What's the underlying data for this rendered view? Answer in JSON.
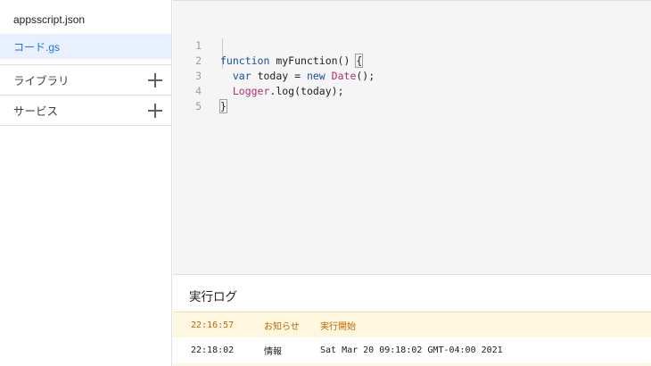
{
  "sidebar": {
    "files": [
      {
        "label": "appsscript.json",
        "selected": false
      },
      {
        "label": "コード.gs",
        "selected": true
      }
    ],
    "sections": [
      {
        "label": "ライブラリ",
        "add_icon": "plus-icon"
      },
      {
        "label": "サービス",
        "add_icon": "plus-icon"
      }
    ]
  },
  "editor": {
    "line_numbers": [
      "1",
      "2",
      "3",
      "4",
      "5"
    ],
    "code": {
      "l1_kw": "function",
      "l1_rest": " myFunction() ",
      "l1_brace": "{",
      "l2_indent": "  ",
      "l2_kw": "var",
      "l2_mid": " today = ",
      "l2_new": "new",
      "l2_sp": " ",
      "l2_cls": "Date",
      "l2_end": "();",
      "l3_indent": "  ",
      "l3_obj": "Logger",
      "l3_rest": ".log(today);",
      "l4_brace": "}"
    }
  },
  "log": {
    "title": "実行ログ",
    "rows": [
      {
        "time": "22:16:57",
        "level": "お知らせ",
        "message": "実行開始"
      },
      {
        "time": "22:18:02",
        "level": "情報",
        "message": "Sat Mar 20 09:18:02 GMT-04:00 2021"
      }
    ]
  },
  "colors": {
    "accent": "#1a73e8",
    "selected_bg": "#e8f0fe",
    "notice_bg": "#fef7e0",
    "notice_text": "#c26401",
    "keyword": "#1a4fa0",
    "class": "#b0306d"
  }
}
